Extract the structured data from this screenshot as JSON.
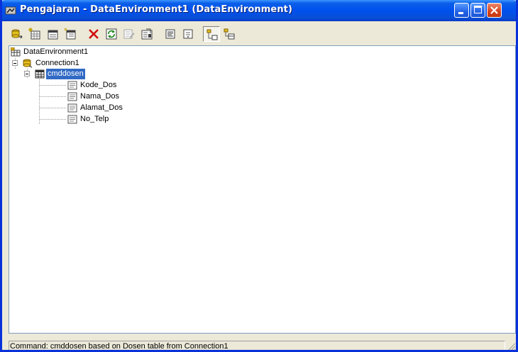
{
  "window": {
    "title": "Pengajaran - DataEnvironment1 (DataEnvironment)",
    "icon": "data-environment-icon"
  },
  "title_buttons": [
    "minimize-button",
    "maximize-button",
    "close-button"
  ],
  "toolbar": {
    "buttons": [
      {
        "icon": "add-connection-icon"
      },
      {
        "icon": "add-command-icon"
      },
      {
        "icon": "insert-stored-procedures-icon"
      },
      {
        "icon": "add-child-command-icon"
      },
      {
        "icon": "delete-icon"
      },
      {
        "icon": "refresh-icon"
      },
      {
        "icon": "design-icon"
      },
      {
        "icon": "properties-icon"
      },
      {
        "icon": "view-code-icon"
      },
      {
        "icon": "options-icon"
      },
      {
        "icon": "arrange-by-connections-icon"
      },
      {
        "icon": "arrange-by-objects-icon"
      }
    ]
  },
  "tree": {
    "root": "DataEnvironment1",
    "connection": "Connection1",
    "command": "cmddosen",
    "fields": [
      "Kode_Dos",
      "Nama_Dos",
      "Alamat_Dos",
      "No_Telp"
    ]
  },
  "statusbar": {
    "text": "Command:  cmddosen based on Dosen  table  from Connection1"
  },
  "colors": {
    "titlebar": "#0a5fe8",
    "selection": "#316ac5"
  }
}
